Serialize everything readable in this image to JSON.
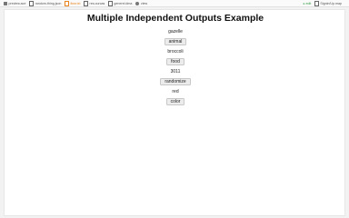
{
  "topbar": {
    "items": [
      {
        "icon": "image-icon",
        "label": "preview.ace"
      },
      {
        "icon": "file-icon",
        "label": "random-thing.json"
      },
      {
        "icon": "file-icon",
        "label": "flow.txt",
        "active": true
      },
      {
        "icon": "file-icon",
        "label": "res.ourcas"
      },
      {
        "icon": "file-icon",
        "label": "generel.dma"
      },
      {
        "icon": "circle-icon",
        "label": "view"
      }
    ],
    "run_label": "▸ edit",
    "right_label": "Signin/Up.map"
  },
  "page": {
    "title": "Multiple Independent Outputs Example",
    "rows": [
      {
        "output": "gazelle",
        "button": "animal"
      },
      {
        "output": "broccoli",
        "button": "food"
      },
      {
        "output": "3011",
        "button": "randomize"
      },
      {
        "output": "red",
        "button": "color"
      }
    ]
  }
}
